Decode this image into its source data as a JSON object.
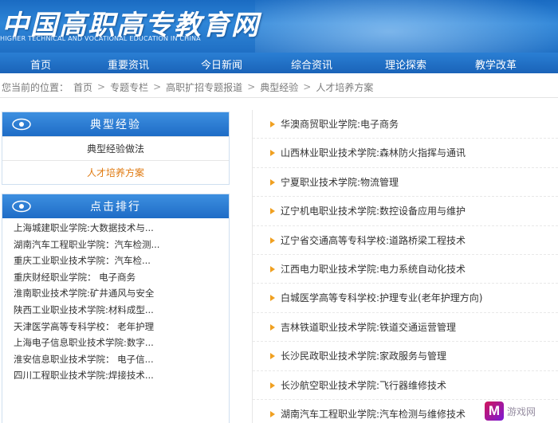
{
  "header": {
    "title": "中国高职高专教育网",
    "subtitle": "HIGHER TECHNICAL AND VOCATIONAL EDUCATION IN CHINA"
  },
  "nav": {
    "items": [
      "首页",
      "重要资讯",
      "今日新闻",
      "综合资讯",
      "理论探索",
      "教学改革"
    ]
  },
  "breadcrumb": {
    "label": "您当前的位置：",
    "items": [
      "首页",
      "专题专栏",
      "高职扩招专题报道",
      "典型经验",
      "人才培养方案"
    ],
    "separator": ">"
  },
  "sidebar": {
    "box1": {
      "title": "典型经验",
      "links": [
        {
          "label": "典型经验做法",
          "active": false
        },
        {
          "label": "人才培养方案",
          "active": true
        }
      ]
    },
    "box2": {
      "title": "点击排行",
      "items": [
        "上海城建职业学院:大数据技术与...",
        "湖南汽车工程职业学院：汽车检测...",
        "重庆工业职业技术学院：汽车检...",
        "重庆财经职业学院： 电子商务",
        "淮南职业技术学院:矿井通风与安全",
        "陕西工业职业技术学院:材料成型...",
        "天津医学高等专科学校： 老年护理",
        "上海电子信息职业技术学院:数字...",
        "淮安信息职业技术学院： 电子信...",
        "四川工程职业技术学院:焊接技术..."
      ]
    }
  },
  "main": {
    "items": [
      "华澳商贸职业学院:电子商务",
      "山西林业职业技术学院:森林防火指挥与通讯",
      "宁夏职业技术学院:物流管理",
      "辽宁机电职业技术学院:数控设备应用与维护",
      "辽宁省交通高等专科学校:道路桥梁工程技术",
      "江西电力职业技术学院:电力系统自动化技术",
      "白城医学高等专科学校:护理专业(老年护理方向)",
      "吉林铁道职业技术学院:铁道交通运营管理",
      "长沙民政职业技术学院:家政服务与管理",
      "长沙航空职业技术学院:飞行器维修技术",
      "湖南汽车工程职业学院:汽车检测与维修技术"
    ]
  },
  "watermark": {
    "text": "游戏网"
  },
  "colors": {
    "header_blue": "#1f6fc4",
    "nav_blue": "#1a63b8",
    "active_orange": "#e07a10",
    "arrow_orange": "#f0a020"
  }
}
